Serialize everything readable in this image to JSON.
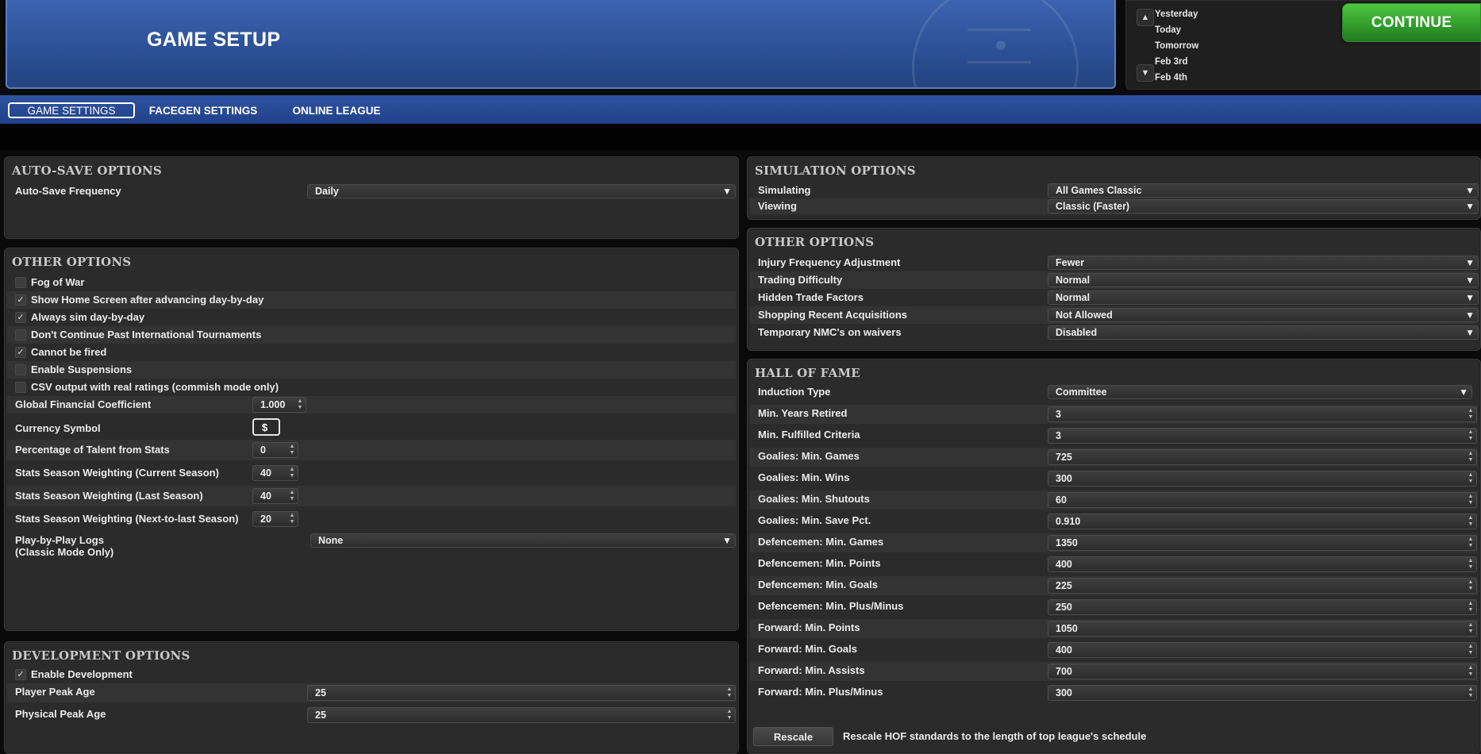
{
  "header": {
    "title": "GAME SETUP",
    "continue_label": "CONTINUE",
    "date_list": [
      "Yesterday",
      "Today",
      "Tomorrow",
      "Feb 3rd",
      "Feb 4th"
    ],
    "up_icon": "triangle-up-icon",
    "down_icon": "triangle-down-icon"
  },
  "tabs": [
    {
      "label": "GAME SETTINGS",
      "active": true
    },
    {
      "label": "FACEGEN SETTINGS",
      "active": false
    },
    {
      "label": "ONLINE LEAGUE",
      "active": false
    }
  ],
  "autosave": {
    "title": "AUTO-SAVE OPTIONS",
    "frequency_label": "Auto-Save Frequency",
    "frequency_value": "Daily"
  },
  "other_left": {
    "title": "OTHER OPTIONS",
    "checkboxes": [
      {
        "label": "Fog of War",
        "checked": false
      },
      {
        "label": "Show Home Screen after advancing day-by-day",
        "checked": true
      },
      {
        "label": "Always sim day-by-day",
        "checked": true
      },
      {
        "label": "Don't Continue Past International Tournaments",
        "checked": false
      },
      {
        "label": "Cannot be fired",
        "checked": true
      },
      {
        "label": "Enable Suspensions",
        "checked": false
      },
      {
        "label": "CSV output with real ratings (commish mode only)",
        "checked": false
      }
    ],
    "financial_label": "Global Financial Coefficient",
    "financial_value": "1.000",
    "currency_label": "Currency Symbol",
    "currency_value": "$",
    "talent_label": "Percentage of Talent from Stats",
    "talent_value": "0",
    "weight_current_label": "Stats Season Weighting (Current Season)",
    "weight_current_value": "40",
    "weight_last_label": "Stats Season Weighting (Last Season)",
    "weight_last_value": "40",
    "weight_next_label": "Stats Season Weighting (Next-to-last Season)",
    "weight_next_value": "20",
    "pbp_label_1": "Play-by-Play Logs",
    "pbp_label_2": "(Classic Mode Only)",
    "pbp_value": "None"
  },
  "development": {
    "title": "DEVELOPMENT OPTIONS",
    "enable_label": "Enable Development",
    "enable_checked": true,
    "player_peak_label": "Player Peak Age",
    "player_peak_value": "25",
    "physical_peak_label": "Physical Peak Age",
    "physical_peak_value": "25"
  },
  "simulation": {
    "title": "SIMULATION OPTIONS",
    "simulating_label": "Simulating",
    "simulating_value": "All Games Classic",
    "viewing_label": "Viewing",
    "viewing_value": "Classic (Faster)"
  },
  "other_right": {
    "title": "OTHER OPTIONS",
    "rows": [
      {
        "label": "Injury Frequency Adjustment",
        "value": "Fewer"
      },
      {
        "label": "Trading Difficulty",
        "value": "Normal"
      },
      {
        "label": "Hidden Trade Factors",
        "value": "Normal"
      },
      {
        "label": "Shopping Recent Acquisitions",
        "value": "Not Allowed"
      },
      {
        "label": "Temporary NMC's on waivers",
        "value": "Disabled"
      }
    ]
  },
  "hof": {
    "title": "HALL OF FAME",
    "induction_label": "Induction Type",
    "induction_value": "Committee",
    "rows": [
      {
        "label": "Min. Years Retired",
        "value": "3"
      },
      {
        "label": "Min. Fulfilled Criteria",
        "value": "3"
      },
      {
        "label": "Goalies: Min. Games",
        "value": "725"
      },
      {
        "label": "Goalies: Min. Wins",
        "value": "300"
      },
      {
        "label": "Goalies: Min. Shutouts",
        "value": "60"
      },
      {
        "label": "Goalies: Min. Save Pct.",
        "value": "0.910"
      },
      {
        "label": "Defencemen: Min. Games",
        "value": "1350"
      },
      {
        "label": "Defencemen: Min. Points",
        "value": "400"
      },
      {
        "label": "Defencemen: Min. Goals",
        "value": "225"
      },
      {
        "label": "Defencemen: Min. Plus/Minus",
        "value": "250"
      },
      {
        "label": "Forward: Min. Points",
        "value": "1050"
      },
      {
        "label": "Forward: Min. Goals",
        "value": "400"
      },
      {
        "label": "Forward: Min. Assists",
        "value": "700"
      },
      {
        "label": "Forward: Min. Plus/Minus",
        "value": "300"
      }
    ],
    "rescale_label": "Rescale",
    "rescale_desc": "Rescale HOF standards to the length of top league's schedule"
  }
}
